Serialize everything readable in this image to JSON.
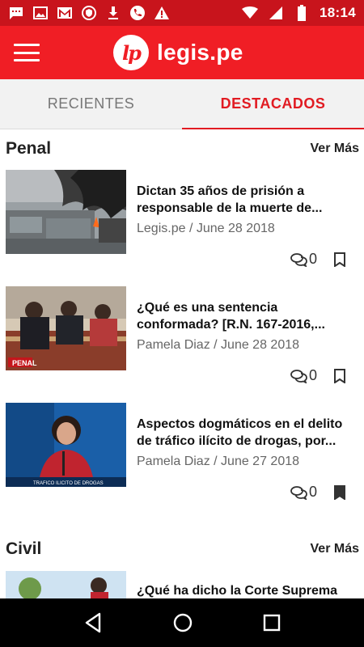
{
  "status_bar": {
    "time": "18:14",
    "icons_left": [
      "chat-icon",
      "image-icon",
      "gmail-icon",
      "vpn-shield-icon",
      "download-icon",
      "phone-icon",
      "alert-icon"
    ],
    "icons_right": [
      "wifi-icon",
      "cellular-signal-icon",
      "battery-icon"
    ]
  },
  "app_bar": {
    "logo_text": "lp",
    "brand": "legis.pe"
  },
  "tabs": [
    {
      "label": "RECIENTES",
      "active": false
    },
    {
      "label": "DESTACADOS",
      "active": true
    }
  ],
  "sections": [
    {
      "title": "Penal",
      "see_more": "Ver Más",
      "articles": [
        {
          "title": "Dictan 35 años de prisión a responsable de la muerte de...",
          "author": "Legis.pe",
          "date": "June 28 2018",
          "meta": "Legis.pe / June 28 2018",
          "comments": "0",
          "bookmarked": false
        },
        {
          "title": "¿Qué es una sentencia conformada? [R.N. 167-2016,...",
          "author": "Pamela Diaz",
          "date": "June 28 2018",
          "meta": "Pamela Diaz / June 28 2018",
          "comments": "0",
          "bookmarked": false
        },
        {
          "title": "Aspectos dogmáticos en el delito de tráfico ilícito de drogas, por...",
          "author": "Pamela Diaz",
          "date": "June 27 2018",
          "meta": "Pamela Diaz / June 27 2018",
          "comments": "0",
          "bookmarked": true
        }
      ]
    },
    {
      "title": "Civil",
      "see_more": "Ver Más",
      "articles": [
        {
          "title": "¿Qué ha dicho la Corte Suprema"
        }
      ]
    }
  ],
  "thumbs": {
    "penal_badge": "PENAL",
    "caption": "TRAFICO ILICITO DE DROGAS"
  },
  "nav_bar": [
    "back-icon",
    "home-icon",
    "recents-icon"
  ],
  "colors": {
    "brand_red": "#f01e25",
    "status_red": "#c8141c",
    "active_tab": "#e11b22"
  }
}
